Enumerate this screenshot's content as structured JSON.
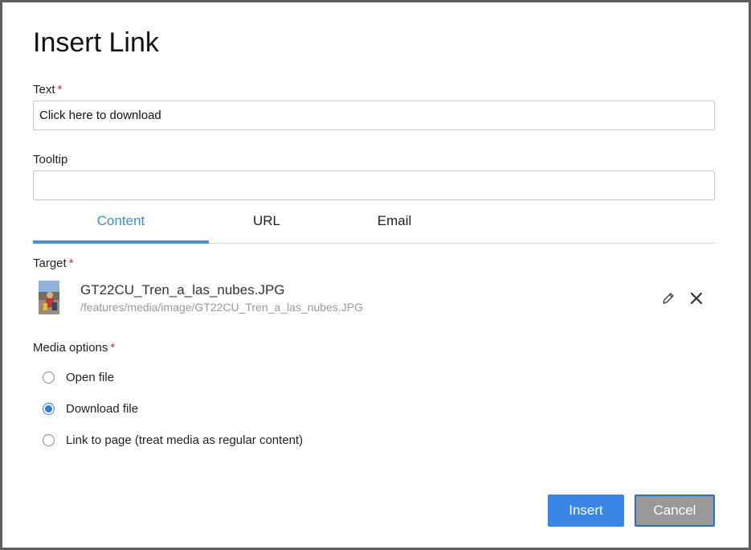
{
  "dialog": {
    "title": "Insert Link"
  },
  "text_field": {
    "label": "Text",
    "required_mark": "*",
    "value": "Click here to download"
  },
  "tooltip_field": {
    "label": "Tooltip",
    "value": ""
  },
  "tabs": [
    {
      "label": "Content",
      "active": true
    },
    {
      "label": "URL",
      "active": false
    },
    {
      "label": "Email",
      "active": false
    }
  ],
  "target": {
    "label": "Target",
    "required_mark": "*",
    "file_name": "GT22CU_Tren_a_las_nubes.JPG",
    "file_path": "/features/media/image/GT22CU_Tren_a_las_nubes.JPG",
    "edit_icon": "pencil-icon",
    "remove_icon": "close-icon"
  },
  "media_options": {
    "label": "Media options",
    "required_mark": "*",
    "options": [
      {
        "label": "Open file",
        "selected": false
      },
      {
        "label": "Download file",
        "selected": true
      },
      {
        "label": "Link to page (treat media as regular content)",
        "selected": false
      }
    ]
  },
  "buttons": {
    "insert_label": "Insert",
    "cancel_label": "Cancel"
  },
  "colors": {
    "accent": "#3a86e6",
    "tab_active": "#3d8ed1",
    "required": "#c0392b",
    "cancel_bg": "#999999"
  }
}
